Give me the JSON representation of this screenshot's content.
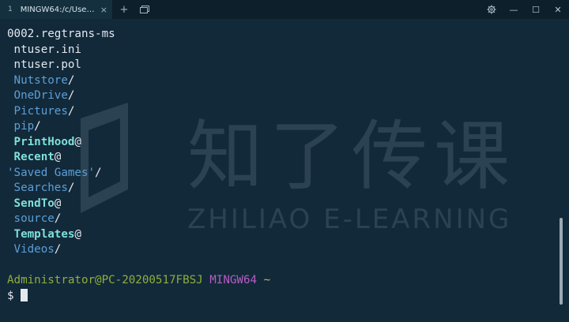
{
  "titlebar": {
    "tab_number": "1",
    "tab_title": "MINGW64:/c/Users/Ad...",
    "tab_close": "×",
    "new_tab": "+",
    "settings_icon": "gear-icon",
    "minimize": "—",
    "maximize": "☐",
    "close": "✕"
  },
  "watermark": {
    "cn": "知了传课",
    "en": "ZHILIAO E-LEARNING"
  },
  "terminal": {
    "lines": [
      {
        "text": "0002.regtrans-ms",
        "suffix": "",
        "style": "plain",
        "indent": ""
      },
      {
        "text": "ntuser.ini",
        "suffix": "",
        "style": "plain",
        "indent": " "
      },
      {
        "text": "ntuser.pol",
        "suffix": "",
        "style": "plain",
        "indent": " "
      },
      {
        "text": "Nutstore",
        "suffix": "/",
        "style": "dir",
        "indent": " "
      },
      {
        "text": "OneDrive",
        "suffix": "/",
        "style": "dir",
        "indent": " "
      },
      {
        "text": "Pictures",
        "suffix": "/",
        "style": "dir",
        "indent": " "
      },
      {
        "text": "pip",
        "suffix": "/",
        "style": "dir",
        "indent": " "
      },
      {
        "text": "PrintHood",
        "suffix": "@",
        "style": "link",
        "indent": " "
      },
      {
        "text": "Recent",
        "suffix": "@",
        "style": "link",
        "indent": " "
      },
      {
        "text": "'Saved Games'",
        "suffix": "/",
        "style": "quoted",
        "indent": ""
      },
      {
        "text": "Searches",
        "suffix": "/",
        "style": "dir",
        "indent": " "
      },
      {
        "text": "SendTo",
        "suffix": "@",
        "style": "link",
        "indent": " "
      },
      {
        "text": "source",
        "suffix": "/",
        "style": "dir",
        "indent": " "
      },
      {
        "text": "Templates",
        "suffix": "@",
        "style": "link",
        "indent": " "
      },
      {
        "text": "Videos",
        "suffix": "/",
        "style": "dir",
        "indent": " "
      }
    ],
    "prompt": {
      "user_host": "Administrator@PC-20200517FBSJ",
      "system": "MINGW64",
      "cwd": "~",
      "symbol": "$"
    }
  }
}
